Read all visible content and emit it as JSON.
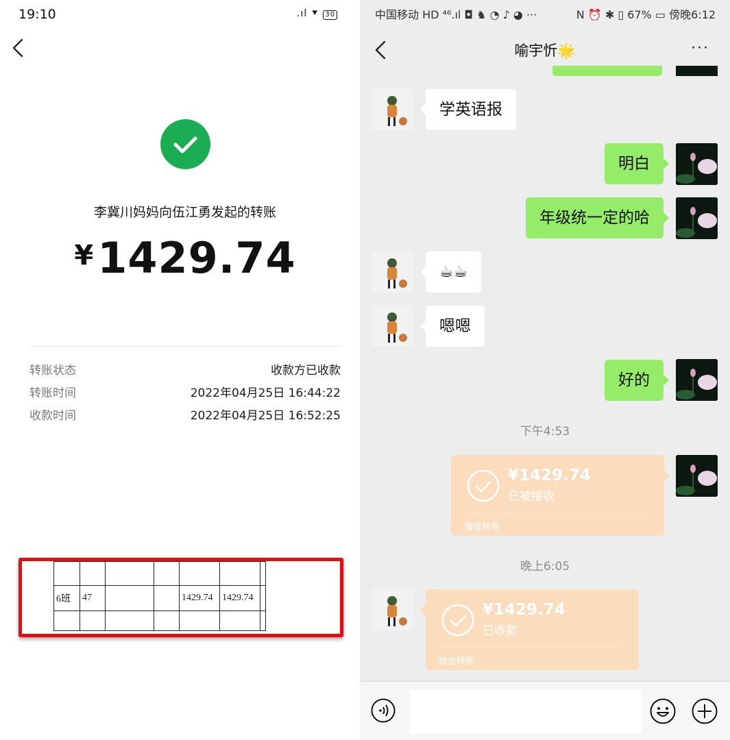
{
  "left": {
    "status_time": "19:10",
    "status_icons": ".ıl ⯆",
    "battery": "30",
    "transfer_title": "李冀川妈妈向伍江勇发起的转账",
    "currency": "¥",
    "amount": "1429.74",
    "rows": [
      {
        "label": "转账状态",
        "value": "收款方已收款"
      },
      {
        "label": "转账时间",
        "value": "2022年04月25日 16:44:22"
      },
      {
        "label": "收款时间",
        "value": "2022年04月25日 16:52:25"
      }
    ],
    "sheet_row": [
      "6班",
      "47",
      "",
      "",
      "1429.74",
      "1429.74"
    ]
  },
  "right": {
    "status_left": "中国移动 HD ⁴⁶.ıl ◘ ♞ ◔ ♪ ◕ ···",
    "status_right": "N ⏰ ✱ ▯ 67% ▭ 傍晚6:12",
    "chat_title": "喻宇忻",
    "chat_title_emoji": "🌟",
    "menu": "···",
    "messages": [
      {
        "side": "other",
        "text": "学英语报"
      },
      {
        "side": "me",
        "text": "明白"
      },
      {
        "side": "me",
        "text": "年级统一定的哈"
      },
      {
        "side": "other",
        "text": "☕☕"
      },
      {
        "side": "other",
        "text": "嗯嗯"
      },
      {
        "side": "me",
        "text": "好的"
      }
    ],
    "time1": "下午4:53",
    "time2": "晚上6:05",
    "transfer1": {
      "amount": "¥1429.74",
      "status": "已被接收",
      "footer": "微信转账"
    },
    "transfer2": {
      "amount": "¥1429.74",
      "status": "已收款",
      "footer": "微信转账"
    }
  },
  "colors": {
    "wechat_green": "#95ec69",
    "success_green": "#1aad53",
    "transfer_orange": "#fbdcbd",
    "highlight_red": "#e40d12"
  }
}
